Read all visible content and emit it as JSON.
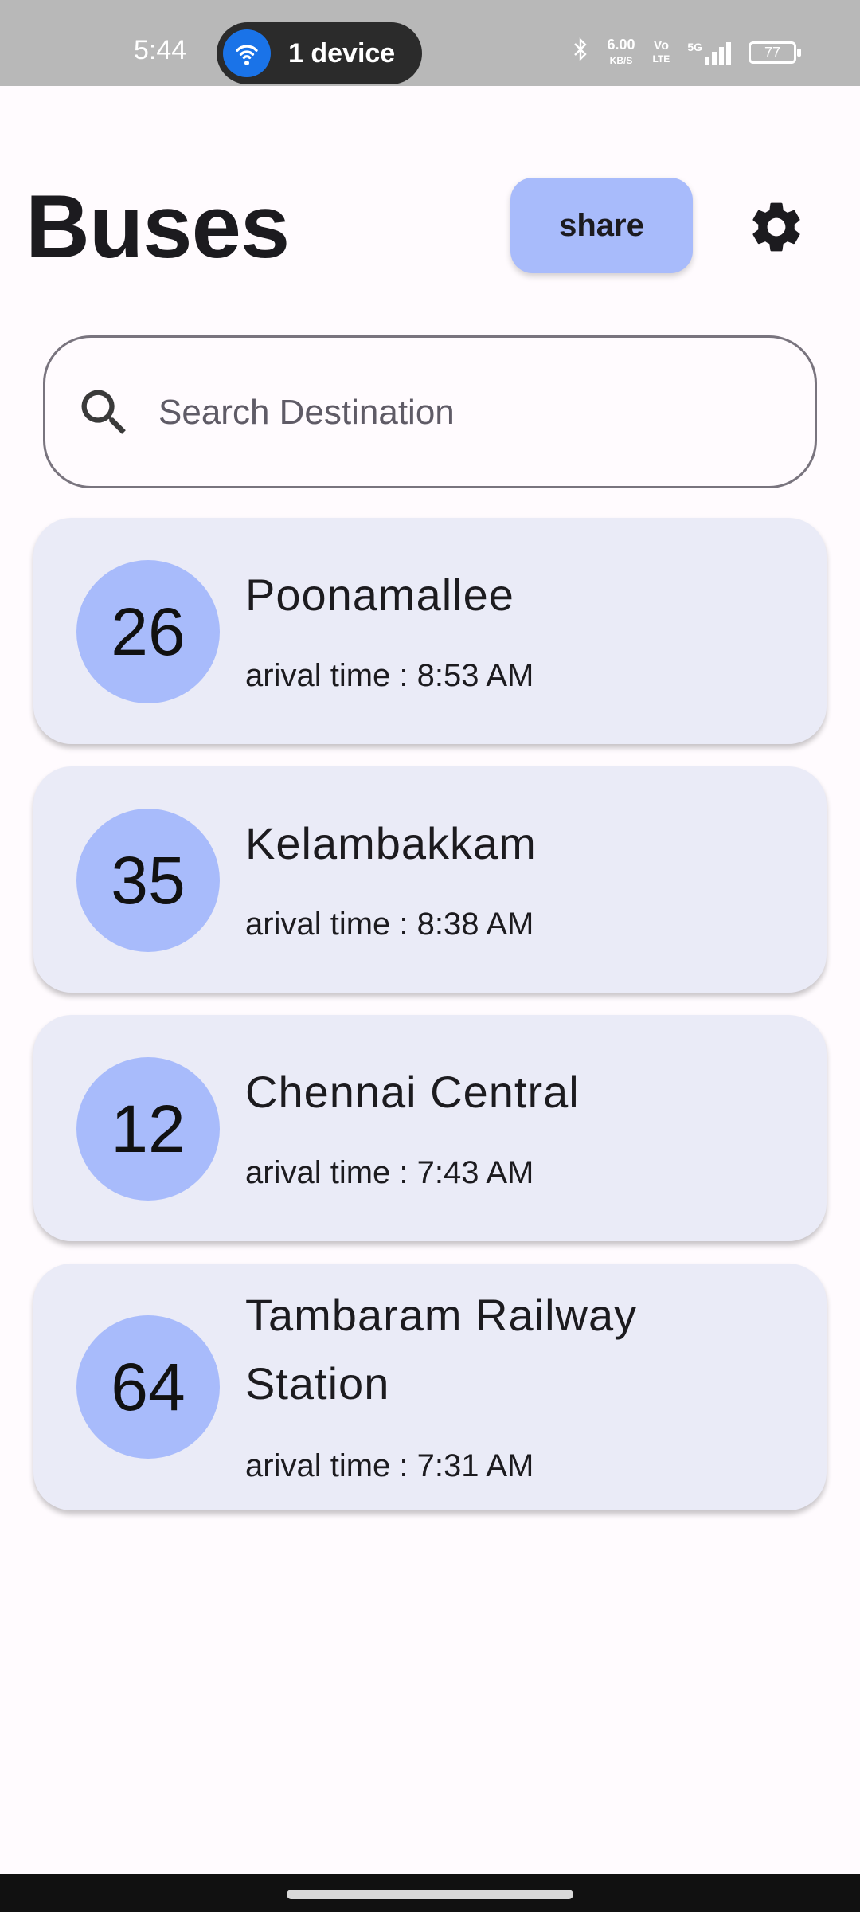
{
  "status_bar": {
    "time": "5:44",
    "device_pill": "1 device",
    "speed_value": "6.00",
    "speed_unit": "KB/S",
    "volte_top": "Vo",
    "volte_bottom": "LTE",
    "network": "5G",
    "battery": "77"
  },
  "header": {
    "title": "Buses",
    "share_label": "share"
  },
  "search": {
    "placeholder": "Search Destination",
    "value": ""
  },
  "buses": [
    {
      "route": "26",
      "destination": "Poonamallee",
      "arrival": "arival time : 8:53 AM"
    },
    {
      "route": "35",
      "destination": "Kelambakkam",
      "arrival": "arival time : 8:38 AM"
    },
    {
      "route": "12",
      "destination": "Chennai Central",
      "arrival": "arival time : 7:43 AM"
    },
    {
      "route": "64",
      "destination": "Tambaram Railway Station",
      "arrival": "arival time : 7:31 AM"
    }
  ],
  "colors": {
    "accent": "#a8bbfb",
    "card_background": "#eaebf7",
    "page_background": "#fffbfe"
  }
}
